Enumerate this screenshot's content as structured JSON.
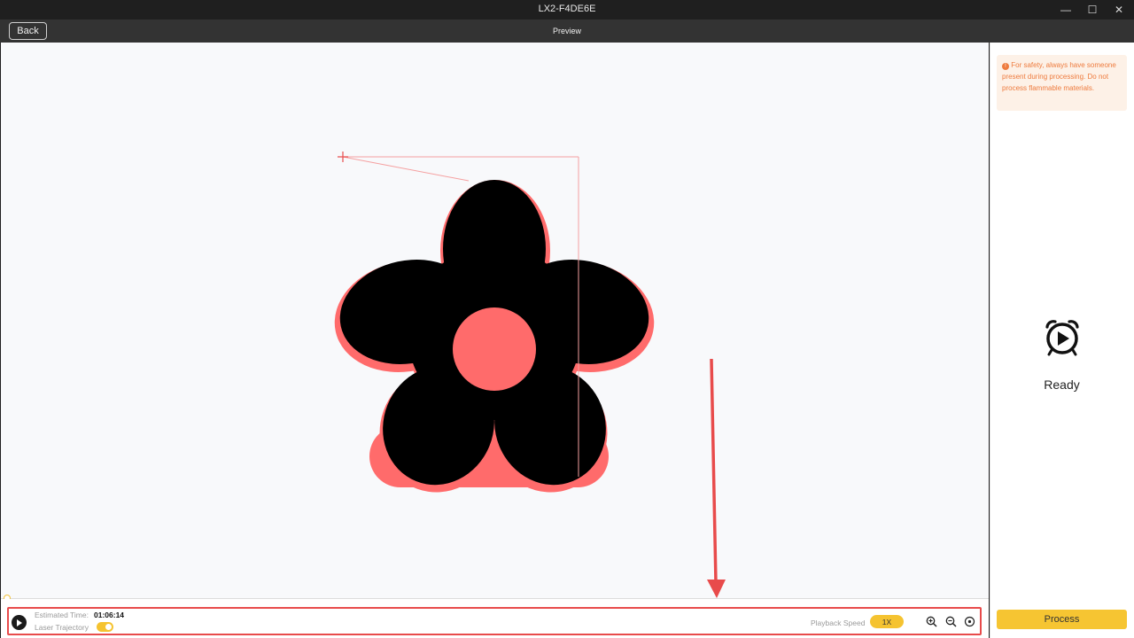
{
  "window": {
    "title": "LX2-F4DE6E",
    "minimize_glyph": "—",
    "maximize_glyph": "☐",
    "close_glyph": "✕"
  },
  "toolbar": {
    "back_label": "Back",
    "page_title": "Preview"
  },
  "playback": {
    "estimated_time_label": "Estimated Time:",
    "estimated_time_value": "01:06:14",
    "laser_trajectory_label": "Laser Trajectory",
    "laser_trajectory_enabled": true,
    "playback_speed_label": "Playback Speed",
    "playback_speed_value": "1X",
    "progress": 0
  },
  "side_panel": {
    "safety_icon": "warning-circle-icon",
    "safety_text": "For safety, always have someone present during processing. Do not process flammable materials.",
    "status_icon": "alarm-clock-play-icon",
    "status_text": "Ready",
    "process_label": "Process"
  },
  "colors": {
    "accent": "#f6c532",
    "laser_red": "#ff6b6b",
    "annotation_red": "#e84b4b",
    "warning_orange": "#ee7b3e"
  }
}
